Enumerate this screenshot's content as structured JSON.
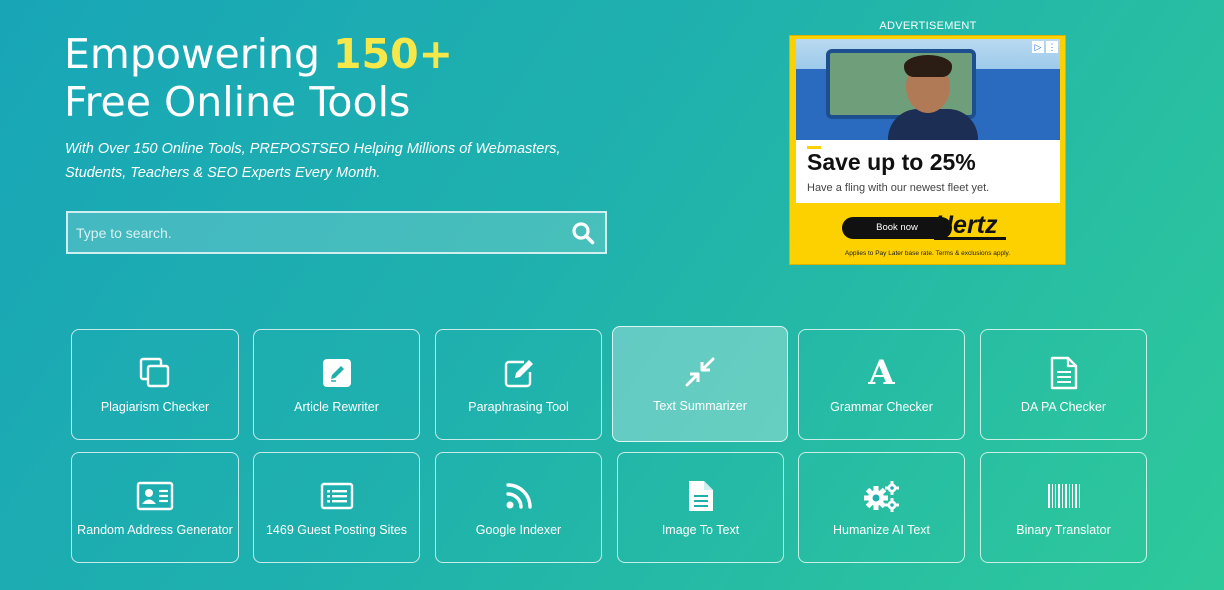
{
  "hero": {
    "title_prefix": "Empowering ",
    "title_accent": "150+",
    "title_line2": "Free Online Tools",
    "subtitle": "With Over 150 Online Tools, PREPOSTSEO Helping Millions of Webmasters, Students, Teachers & SEO Experts Every Month."
  },
  "search": {
    "placeholder": "Type to search.",
    "value": "",
    "icon": "search-icon"
  },
  "ad": {
    "label": "ADVERTISEMENT",
    "headline": "Save up to 25%",
    "body": "Have a fling with our newest fleet yet.",
    "cta": "Book now",
    "brand": "Hertz",
    "disclaimer": "Applies to Pay Later base rate. Terms & exclusions apply.",
    "brand_color": "#fdd000"
  },
  "tools": [
    {
      "label": "Plagiarism Checker",
      "icon": "copy-icon"
    },
    {
      "label": "Article Rewriter",
      "icon": "pencil-square-icon"
    },
    {
      "label": "Paraphrasing Tool",
      "icon": "edit-icon"
    },
    {
      "label": "Text Summarizer",
      "icon": "compress-icon",
      "active": true
    },
    {
      "label": "Grammar Checker",
      "icon": "letter-a-icon"
    },
    {
      "label": "DA PA Checker",
      "icon": "document-icon"
    },
    {
      "label": "Random Address Generator",
      "icon": "id-card-icon"
    },
    {
      "label": "1469 Guest Posting Sites",
      "icon": "list-icon"
    },
    {
      "label": "Google Indexer",
      "icon": "rss-icon"
    },
    {
      "label": "Image To Text",
      "icon": "file-text-icon"
    },
    {
      "label": "Humanize AI Text",
      "icon": "gears-icon"
    },
    {
      "label": "Binary Translator",
      "icon": "barcode-icon"
    }
  ],
  "colors": {
    "accent_yellow": "#f6e84a",
    "bg_start": "#18a6b7",
    "bg_end": "#2ec99a"
  }
}
